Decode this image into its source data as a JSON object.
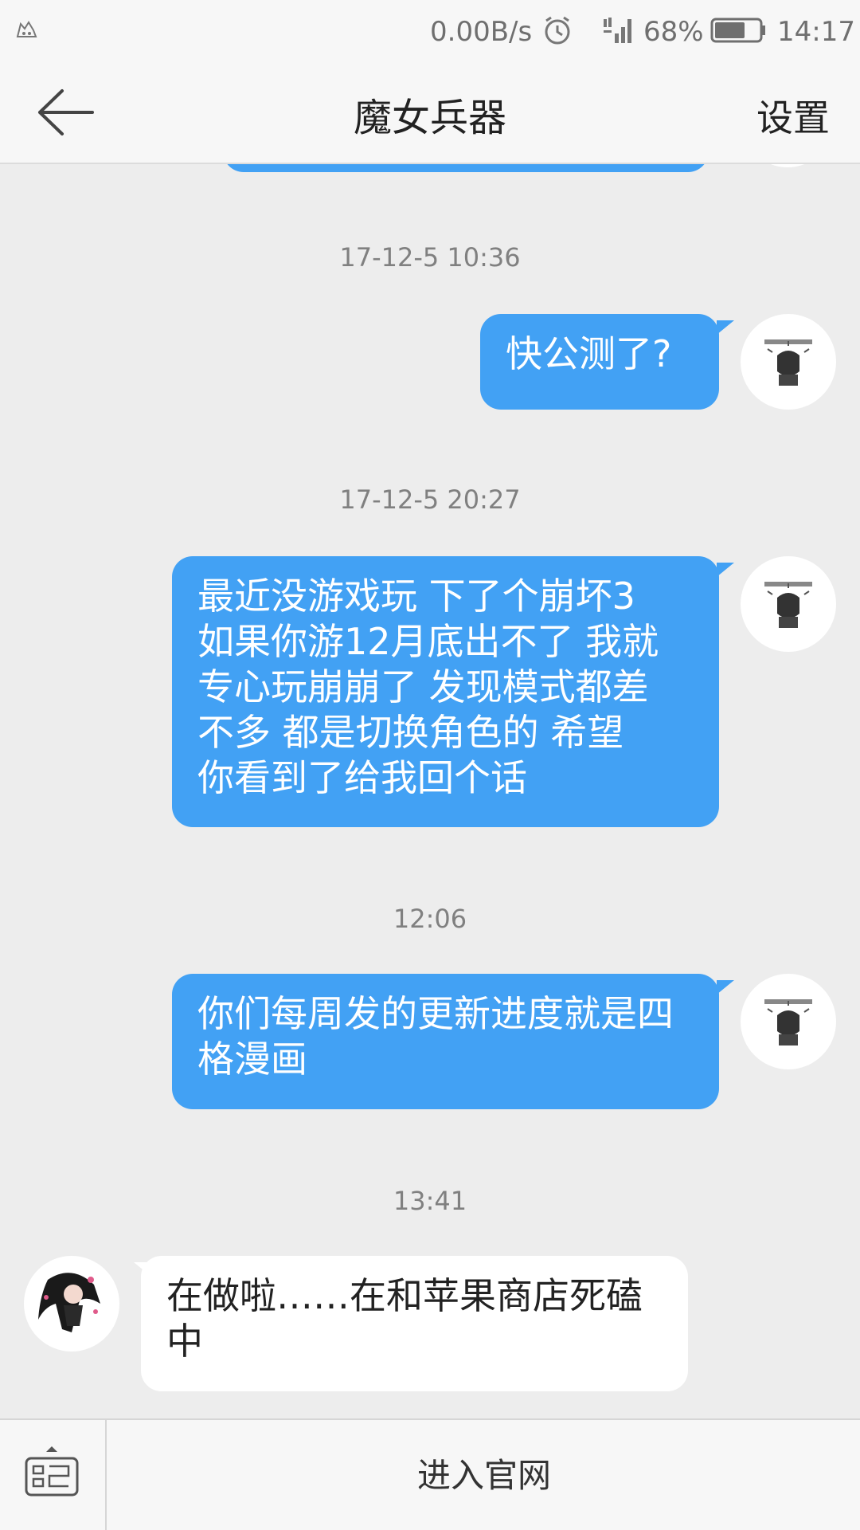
{
  "status_bar": {
    "net_speed": "0.00B/s",
    "battery_percent": "68%",
    "battery_level": 0.68,
    "time": "14:17"
  },
  "header": {
    "title": "魔女兵器",
    "settings_label": "设置"
  },
  "messages": [
    {
      "timestamp": "17-12-5 10:36",
      "direction": "out",
      "text": "快公测了?"
    },
    {
      "timestamp": "17-12-5 20:27",
      "direction": "out",
      "lines": [
        "最近没游戏玩  下了个崩坏3",
        "如果你游12月底出不了  我就",
        "专心玩崩崩了   发现模式都差",
        "不多    都是切换角色的   希望",
        "你看到了给我回个话"
      ]
    },
    {
      "timestamp": "12:06",
      "direction": "out",
      "lines": [
        "你们每周发的更新进度就是四",
        "格漫画"
      ]
    },
    {
      "timestamp": "13:41",
      "direction": "in",
      "lines": [
        "在做啦……在和苹果商店死磕",
        "中"
      ]
    }
  ],
  "footer": {
    "official_site_label": "进入官网"
  },
  "icons": {
    "back": "back-arrow-icon",
    "alarm": "alarm-clock-icon",
    "signal": "signal-icon",
    "battery": "battery-icon",
    "keyboard": "keyboard-toggle-icon"
  },
  "colors": {
    "bubble_out": "#42a1f4",
    "bubble_in": "#ffffff",
    "background": "#ededed"
  }
}
